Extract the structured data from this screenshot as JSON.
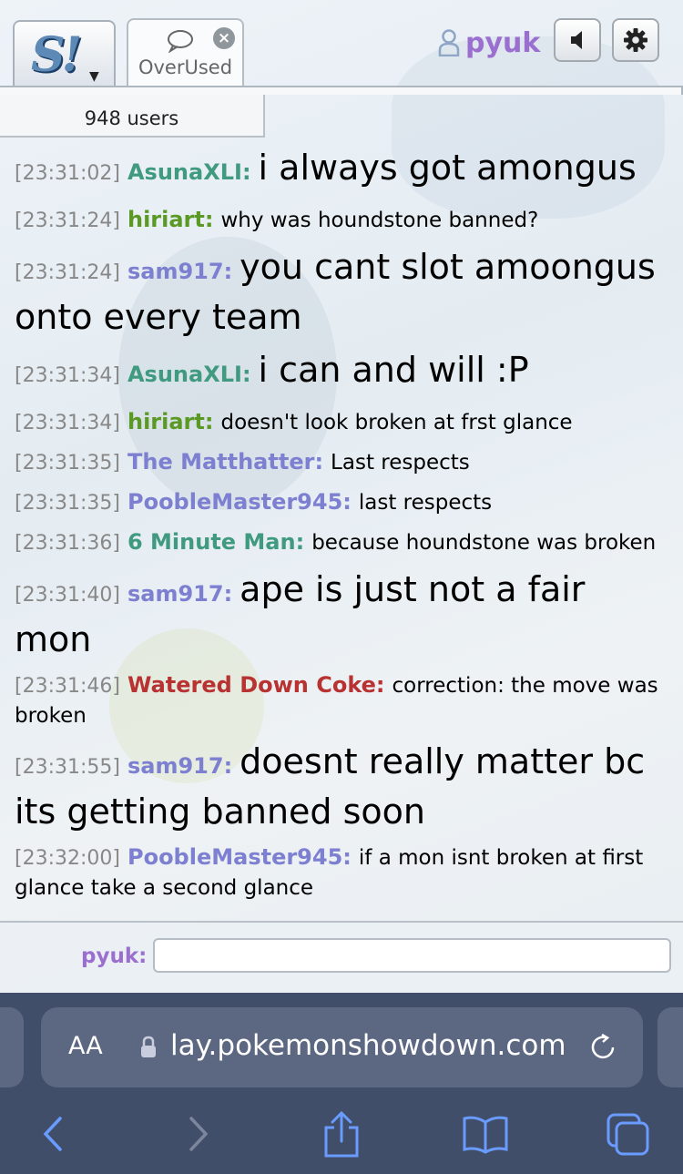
{
  "header": {
    "room_tab_label": "OverUsed",
    "username": "pyuk"
  },
  "users_count": "948 users",
  "messages": [
    {
      "time": "[23:31:02]",
      "user": "AsunaXLI:",
      "color": "#3f9a80",
      "text": "i always got amongus",
      "size": "big"
    },
    {
      "time": "[23:31:24]",
      "user": "hiriart:",
      "color": "#5a9a24",
      "text": "why was houndstone banned?",
      "size": "small"
    },
    {
      "time": "[23:31:24]",
      "user": "sam917:",
      "color": "#7d7fd0",
      "text": "you cant slot amoongus onto every team",
      "size": "big"
    },
    {
      "time": "[23:31:34]",
      "user": "AsunaXLI:",
      "color": "#3f9a80",
      "text": "i can and will :P",
      "size": "big"
    },
    {
      "time": "[23:31:34]",
      "user": "hiriart:",
      "color": "#5a9a24",
      "text": "doesn't look broken at frst glance",
      "size": "small"
    },
    {
      "time": "[23:31:35]",
      "user": "The Matthatter:",
      "color": "#7d7fd0",
      "text": "Last respects",
      "size": "small"
    },
    {
      "time": "[23:31:35]",
      "user": "PoobleMaster945:",
      "color": "#7d7fd0",
      "text": "last respects",
      "size": "small"
    },
    {
      "time": "[23:31:36]",
      "user": "6 Minute Man:",
      "color": "#3f9a80",
      "text": "because houndstone was broken",
      "size": "small"
    },
    {
      "time": "[23:31:40]",
      "user": "sam917:",
      "color": "#7d7fd0",
      "text": "ape is just not a fair mon",
      "size": "big"
    },
    {
      "time": "[23:31:46]",
      "user": "Watered Down Coke:",
      "color": "#b83232",
      "text": "correction: the move was broken",
      "size": "small"
    },
    {
      "time": "[23:31:55]",
      "user": "sam917:",
      "color": "#7d7fd0",
      "text": "doesnt really matter bc its getting banned soon",
      "size": "big"
    },
    {
      "time": "[23:32:00]",
      "user": "PoobleMaster945:",
      "color": "#7d7fd0",
      "text": "if a mon isnt broken at first glance take a second glance",
      "size": "small"
    }
  ],
  "input": {
    "label": "pyuk:",
    "value": ""
  },
  "browser": {
    "aa_label": "AA",
    "url": "lay.pokemonshowdown.com"
  },
  "colors": {
    "username_purple": "#9b6fd0",
    "safari_bg": "#414e69",
    "safari_field": "#5c6781",
    "safari_accent": "#6a9bff"
  }
}
